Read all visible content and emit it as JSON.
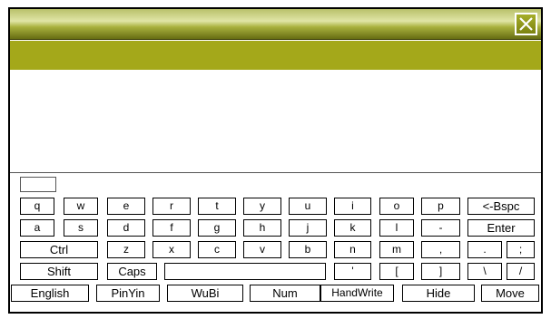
{
  "close_icon": "close-x-icon",
  "colors": {
    "title_gradient_top": "#b9c16a",
    "title_gradient_bottom": "#666c12",
    "menubar": "#a4a81a",
    "key_border": "#000000",
    "background": "#ffffff"
  },
  "input": {
    "value": "",
    "placeholder": ""
  },
  "keyboard": {
    "row1": [
      "q",
      "w",
      "e",
      "r",
      "t",
      "y",
      "u",
      "i",
      "o",
      "p",
      "<-Bspc"
    ],
    "row2": [
      "a",
      "s",
      "d",
      "f",
      "g",
      "h",
      "j",
      "k",
      "l",
      "-",
      "Enter"
    ],
    "row3": [
      "Ctrl",
      "z",
      "x",
      "c",
      "v",
      "b",
      "n",
      "m",
      ",",
      ".",
      ";"
    ],
    "row4": [
      "Shift",
      "Caps",
      "",
      "'",
      "[",
      "]",
      "\\",
      "/"
    ],
    "row5": [
      "English",
      "PinYin",
      "WuBi",
      "Num",
      "HandWrite",
      "Hide",
      "Move"
    ]
  }
}
